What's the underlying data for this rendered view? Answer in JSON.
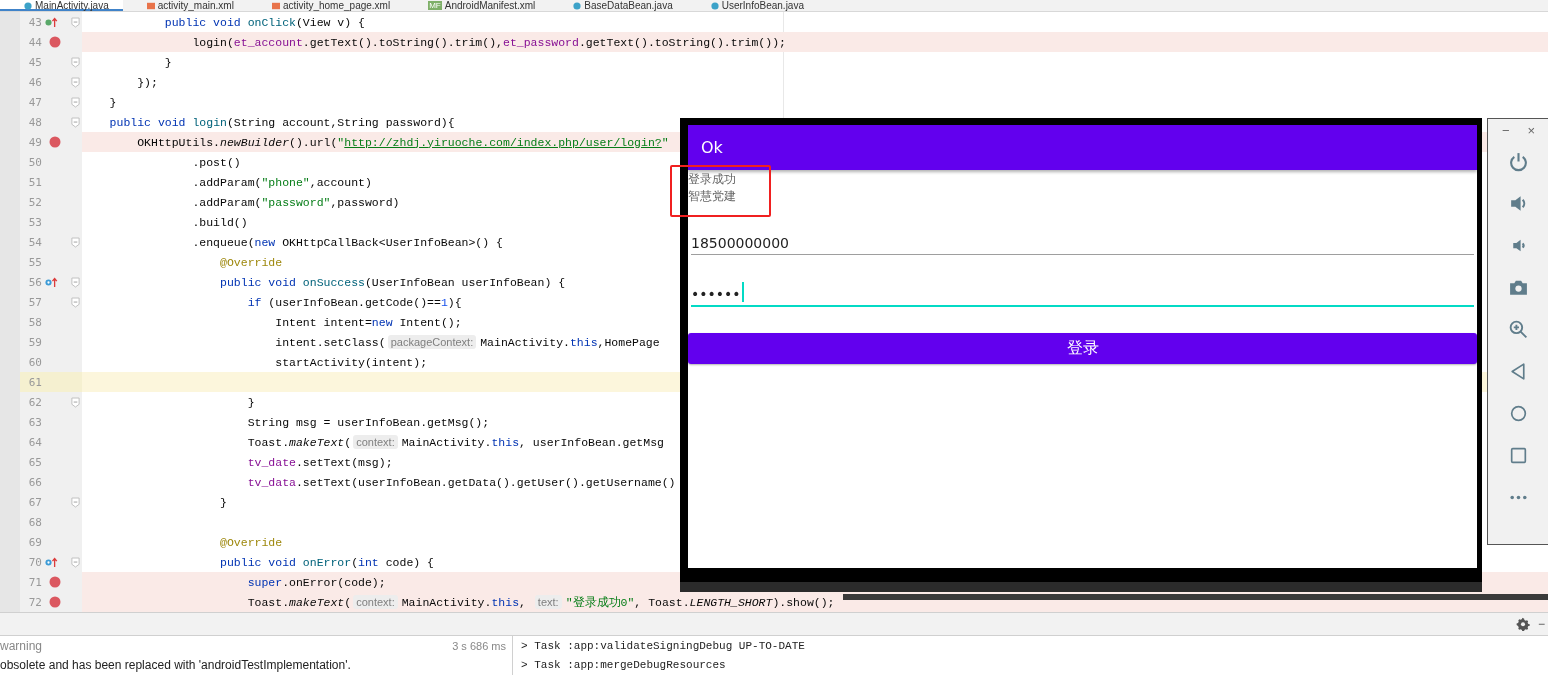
{
  "tabs": [
    {
      "label": "MainActivity.java",
      "kind": "class",
      "selected": true
    },
    {
      "label": "activity_main.xml",
      "kind": "xml",
      "selected": false
    },
    {
      "label": "activity_home_page.xml",
      "kind": "xml",
      "selected": false
    },
    {
      "label": "AndroidManifest.xml",
      "kind": "manifest",
      "badge": "MF",
      "selected": false
    },
    {
      "label": "BaseDataBean.java",
      "kind": "class",
      "selected": false
    },
    {
      "label": "UserInfoBean.java",
      "kind": "class",
      "selected": false
    }
  ],
  "editor": {
    "lines": [
      {
        "number": "43",
        "kind": "implementing",
        "breakpoint": false,
        "current": false,
        "fold": true,
        "tokens": [
          {
            "kind": "kw",
            "text": "            public void "
          },
          {
            "kind": "fn",
            "text": "onClick"
          },
          {
            "kind": "p",
            "text": "(View v) {"
          }
        ]
      },
      {
        "number": "44",
        "breakpoint": true,
        "current": false,
        "fold": false,
        "tokens": [
          {
            "kind": "p",
            "text": "                login("
          },
          {
            "kind": "field",
            "text": "et_account"
          },
          {
            "kind": "p",
            "text": ".getText().toString().trim(),"
          },
          {
            "kind": "field",
            "text": "et_password"
          },
          {
            "kind": "p",
            "text": ".getText().toString().trim());"
          }
        ]
      },
      {
        "number": "45",
        "breakpoint": false,
        "current": false,
        "fold": true,
        "tokens": [
          {
            "kind": "p",
            "text": "            }"
          }
        ]
      },
      {
        "number": "46",
        "breakpoint": false,
        "current": false,
        "fold": true,
        "tokens": [
          {
            "kind": "p",
            "text": "        });"
          }
        ]
      },
      {
        "number": "47",
        "breakpoint": false,
        "current": false,
        "fold": true,
        "tokens": [
          {
            "kind": "p",
            "text": "    }"
          }
        ]
      },
      {
        "number": "48",
        "breakpoint": false,
        "current": false,
        "fold": true,
        "tokens": [
          {
            "kind": "kw",
            "text": "    public void "
          },
          {
            "kind": "fn",
            "text": "login"
          },
          {
            "kind": "p",
            "text": "(String account,String password){"
          }
        ]
      },
      {
        "number": "49",
        "breakpoint": true,
        "current": false,
        "fold": false,
        "tokens": [
          {
            "kind": "p",
            "text": "        OKHttpUtils."
          },
          {
            "kind": "static",
            "text": "newBuilder"
          },
          {
            "kind": "p",
            "text": "().url("
          },
          {
            "kind": "str",
            "text": "\""
          },
          {
            "kind": "link",
            "text": "http://zhdj.yiruoche.com/index.php/user/login?"
          },
          {
            "kind": "str",
            "text": "\""
          }
        ]
      },
      {
        "number": "50",
        "breakpoint": false,
        "current": false,
        "fold": false,
        "tokens": [
          {
            "kind": "p",
            "text": "                .post()"
          }
        ]
      },
      {
        "number": "51",
        "breakpoint": false,
        "current": false,
        "fold": false,
        "tokens": [
          {
            "kind": "p",
            "text": "                .addParam("
          },
          {
            "kind": "str",
            "text": "\"phone\""
          },
          {
            "kind": "p",
            "text": ",account)"
          }
        ]
      },
      {
        "number": "52",
        "breakpoint": false,
        "current": false,
        "fold": false,
        "tokens": [
          {
            "kind": "p",
            "text": "                .addParam("
          },
          {
            "kind": "str",
            "text": "\"password\""
          },
          {
            "kind": "p",
            "text": ",password)"
          }
        ]
      },
      {
        "number": "53",
        "breakpoint": false,
        "current": false,
        "fold": false,
        "tokens": [
          {
            "kind": "p",
            "text": "                .build()"
          }
        ]
      },
      {
        "number": "54",
        "breakpoint": false,
        "current": false,
        "fold": true,
        "tokens": [
          {
            "kind": "p",
            "text": "                .enqueue("
          },
          {
            "kind": "kw",
            "text": "new "
          },
          {
            "kind": "p",
            "text": "OKHttpCallBack<UserInfoBean>() {"
          }
        ]
      },
      {
        "number": "55",
        "breakpoint": false,
        "current": false,
        "fold": false,
        "tokens": [
          {
            "kind": "anno",
            "text": "                    @Override"
          }
        ]
      },
      {
        "number": "56",
        "kind": "overriding",
        "breakpoint": false,
        "current": false,
        "fold": true,
        "tokens": [
          {
            "kind": "kw",
            "text": "                    public void "
          },
          {
            "kind": "fn",
            "text": "onSuccess"
          },
          {
            "kind": "p",
            "text": "(UserInfoBean userInfoBean) {"
          }
        ]
      },
      {
        "number": "57",
        "breakpoint": false,
        "current": false,
        "fold": true,
        "tokens": [
          {
            "kind": "kw",
            "text": "                        if "
          },
          {
            "kind": "p",
            "text": "(userInfoBean.getCode()=="
          },
          {
            "kind": "num",
            "text": "1"
          },
          {
            "kind": "p",
            "text": "){"
          }
        ]
      },
      {
        "number": "58",
        "breakpoint": false,
        "current": false,
        "fold": false,
        "tokens": [
          {
            "kind": "p",
            "text": "                            Intent intent="
          },
          {
            "kind": "kw",
            "text": "new "
          },
          {
            "kind": "p",
            "text": "Intent();"
          }
        ]
      },
      {
        "number": "59",
        "breakpoint": false,
        "current": false,
        "fold": false,
        "tokens": [
          {
            "kind": "p",
            "text": "                            intent.setClass("
          },
          {
            "kind": "hint",
            "text": "packageContext:"
          },
          {
            "kind": "p",
            "text": "MainActivity."
          },
          {
            "kind": "kw",
            "text": "this"
          },
          {
            "kind": "p",
            "text": ",HomePage"
          }
        ]
      },
      {
        "number": "60",
        "breakpoint": false,
        "current": false,
        "fold": false,
        "tokens": [
          {
            "kind": "p",
            "text": "                            startActivity(intent);"
          }
        ]
      },
      {
        "number": "61",
        "breakpoint": false,
        "current": true,
        "fold": false
      },
      {
        "number": "62",
        "breakpoint": false,
        "current": false,
        "fold": true,
        "tokens": [
          {
            "kind": "p",
            "text": "                        }"
          }
        ]
      },
      {
        "number": "63",
        "breakpoint": false,
        "current": false,
        "fold": false,
        "tokens": [
          {
            "kind": "p",
            "text": "                        String msg = userInfoBean.getMsg();"
          }
        ]
      },
      {
        "number": "64",
        "breakpoint": false,
        "current": false,
        "fold": false,
        "tokens": [
          {
            "kind": "p",
            "text": "                        Toast."
          },
          {
            "kind": "static",
            "text": "makeText"
          },
          {
            "kind": "p",
            "text": "("
          },
          {
            "kind": "hint",
            "text": "context:"
          },
          {
            "kind": "p",
            "text": "MainActivity."
          },
          {
            "kind": "kw",
            "text": "this"
          },
          {
            "kind": "p",
            "text": ", userInfoBean.getMsg"
          }
        ]
      },
      {
        "number": "65",
        "breakpoint": false,
        "current": false,
        "fold": false,
        "tokens": [
          {
            "kind": "field",
            "text": "                        tv_date"
          },
          {
            "kind": "p",
            "text": ".setText(msg);"
          }
        ]
      },
      {
        "number": "66",
        "breakpoint": false,
        "current": false,
        "fold": false,
        "tokens": [
          {
            "kind": "field",
            "text": "                        tv_data"
          },
          {
            "kind": "p",
            "text": ".setText(userInfoBean.getData().getUser().getUsername()"
          }
        ]
      },
      {
        "number": "67",
        "breakpoint": false,
        "current": false,
        "fold": true,
        "tokens": [
          {
            "kind": "p",
            "text": "                    }"
          }
        ]
      },
      {
        "number": "68",
        "breakpoint": false,
        "current": false,
        "fold": false
      },
      {
        "number": "69",
        "breakpoint": false,
        "current": false,
        "fold": false,
        "tokens": [
          {
            "kind": "anno",
            "text": "                    @Override"
          }
        ]
      },
      {
        "number": "70",
        "kind": "overriding",
        "breakpoint": false,
        "current": false,
        "fold": true,
        "tokens": [
          {
            "kind": "kw",
            "text": "                    public void "
          },
          {
            "kind": "fn",
            "text": "onError"
          },
          {
            "kind": "p",
            "text": "("
          },
          {
            "kind": "kw",
            "text": "int"
          },
          {
            "kind": "p",
            "text": " code) {"
          }
        ]
      },
      {
        "number": "71",
        "breakpoint": true,
        "current": false,
        "fold": false,
        "tokens": [
          {
            "kind": "kw",
            "text": "                        super"
          },
          {
            "kind": "p",
            "text": ".onError(code);"
          }
        ]
      },
      {
        "number": "72",
        "breakpoint": true,
        "current": false,
        "fold": false,
        "tokens": [
          {
            "kind": "p",
            "text": "                        Toast."
          },
          {
            "kind": "static",
            "text": "makeText"
          },
          {
            "kind": "p",
            "text": "("
          },
          {
            "kind": "hint",
            "text": "context:"
          },
          {
            "kind": "p",
            "text": "MainActivity."
          },
          {
            "kind": "kw",
            "text": "this"
          },
          {
            "kind": "p",
            "text": ", "
          },
          {
            "kind": "hint",
            "text": "text:"
          },
          {
            "kind": "str",
            "text": "\"登录成功0\""
          },
          {
            "kind": "p",
            "text": ", Toast."
          },
          {
            "kind": "static",
            "text": "LENGTH_SHORT"
          },
          {
            "kind": "p",
            "text": ").show();"
          }
        ]
      }
    ]
  },
  "emulator": {
    "app_title": "Ok",
    "messages": [
      "登录成功",
      "智慧党建"
    ],
    "fields": [
      {
        "value": "18500000000",
        "focused": false
      },
      {
        "value": "••••••",
        "focused": true
      }
    ],
    "button": "登录"
  },
  "emulator_toolbar": {
    "minimize": "−",
    "close": "×"
  },
  "bottom_toolbar": {
    "hide": "−"
  },
  "build_output": {
    "items": [
      {
        "text": "warning",
        "time": "3 s 686 ms"
      },
      {
        "text": "obsolete and has been replaced with 'androidTestImplementation'."
      }
    ],
    "log": [
      "> Task :app:validateSigningDebug UP-TO-DATE",
      "> Task :app:mergeDebugResources"
    ]
  }
}
